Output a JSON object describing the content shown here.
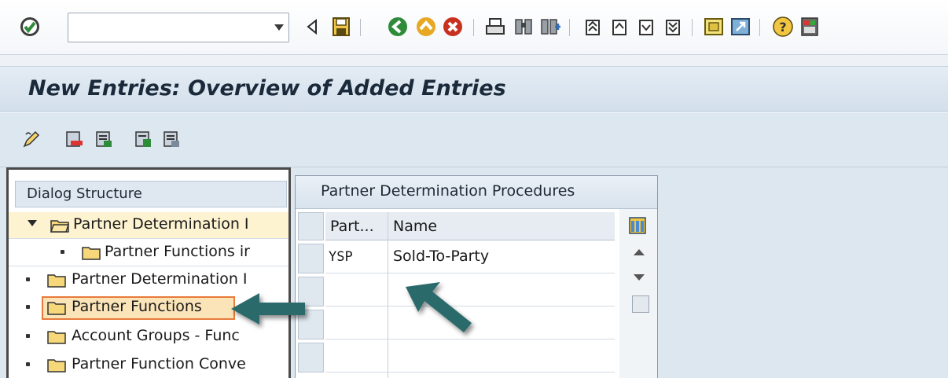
{
  "toolbar": {
    "command_field": {
      "value": "",
      "placeholder": ""
    },
    "icons": [
      "enter-icon",
      "back-icon",
      "save-icon",
      "green-back-icon",
      "exit-icon",
      "cancel-icon",
      "print-icon",
      "find-icon",
      "find-next-icon",
      "first-page-icon",
      "previous-page-icon",
      "next-page-icon",
      "last-page-icon",
      "create-session-icon",
      "shortcut-icon",
      "help-icon",
      "customize-layout-icon"
    ]
  },
  "title": "New Entries: Overview of Added Entries",
  "app_toolbar": {
    "icons": [
      "change-display-icon",
      "delete-icon",
      "select-all-icon",
      "select-block-icon",
      "deselect-all-icon"
    ]
  },
  "dialog_structure": {
    "header": "Dialog Structure",
    "items": [
      {
        "label": "Partner Determination I",
        "level": 0,
        "expanded": true,
        "open_folder": true
      },
      {
        "label": "Partner Functions ir",
        "level": 1
      },
      {
        "label": "Partner Determination I",
        "level": 0
      },
      {
        "label": "Partner Functions",
        "level": 0,
        "selected": true
      },
      {
        "label": "Account Groups - Func",
        "level": 0
      },
      {
        "label": "Partner Function Conve",
        "level": 0
      }
    ]
  },
  "table": {
    "title": "Partner Determination Procedures",
    "columns": [
      "Part...",
      "Name"
    ],
    "rows": [
      {
        "part": "YSP",
        "name": "Sold-To-Party"
      },
      {
        "part": "",
        "name": ""
      },
      {
        "part": "",
        "name": ""
      },
      {
        "part": "",
        "name": ""
      }
    ]
  },
  "colors": {
    "title_bg": "#d3dfeb",
    "arrow": "#2c6a6a",
    "selection": "#fbe4b8",
    "selection_border": "#e87a3a"
  }
}
